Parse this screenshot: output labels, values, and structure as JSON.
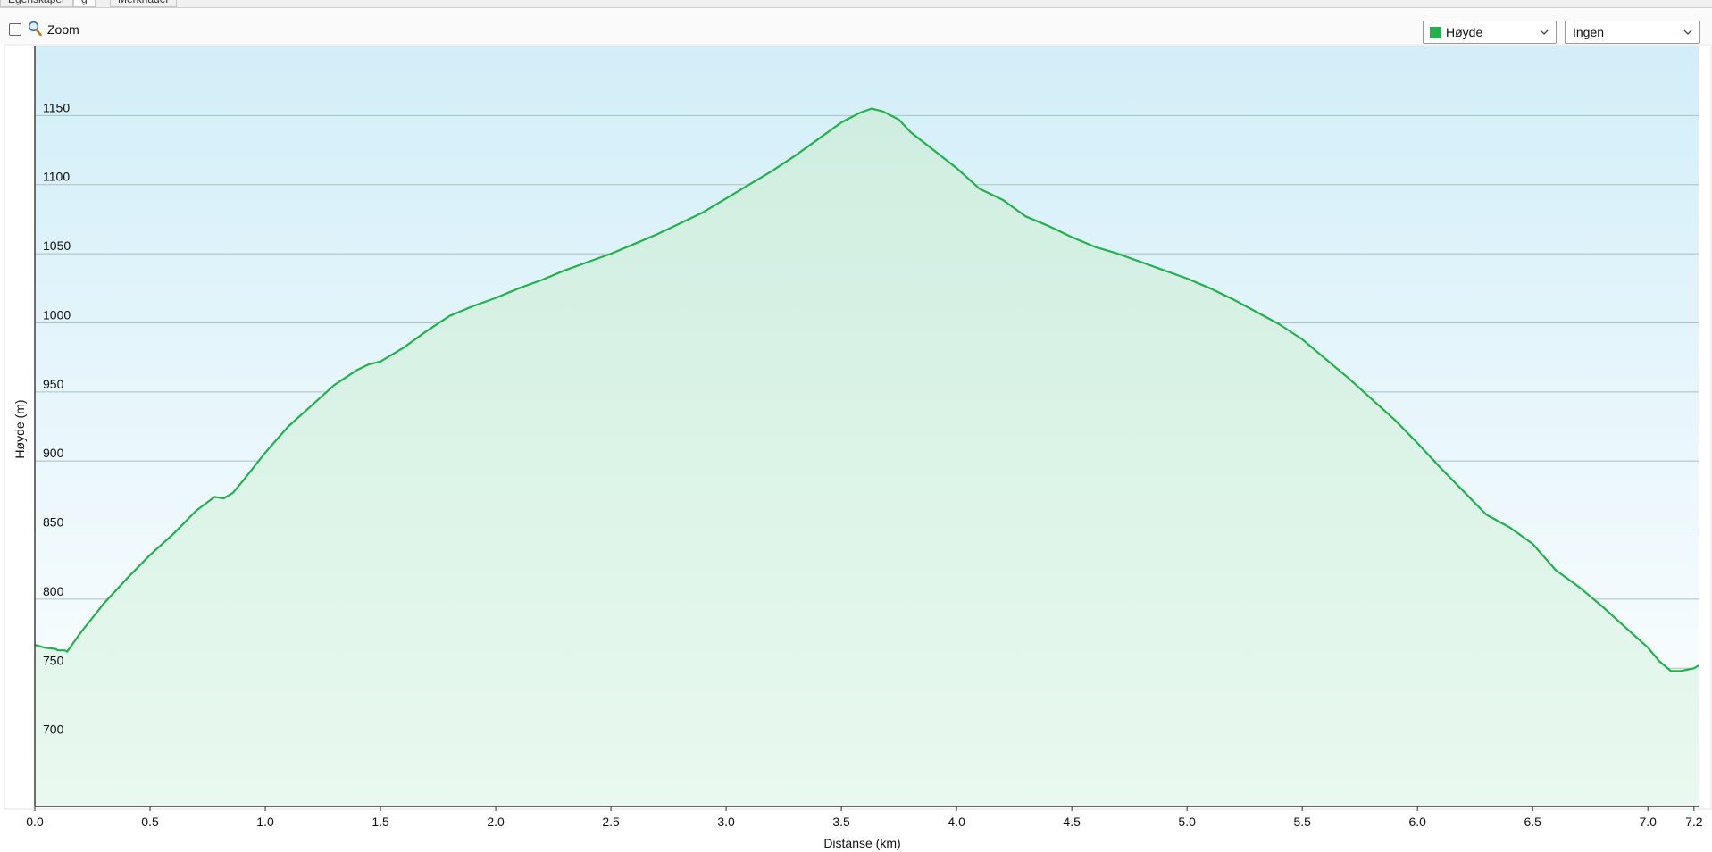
{
  "tabs": [
    {
      "label": "Egenskaper"
    },
    {
      "label": "g"
    },
    {
      "label": "Merknader"
    }
  ],
  "toolbar": {
    "zoom_label": "Zoom",
    "zoom_checked": false,
    "series_select": {
      "value": "Høyde",
      "color": "#22b14c"
    },
    "secondary_select": {
      "value": "Ingen"
    }
  },
  "chart_data": {
    "type": "area",
    "title": "",
    "xlabel": "Distanse  (km)",
    "ylabel": "Høyde (m)",
    "xlim": [
      0,
      7.22
    ],
    "ylim": [
      650,
      1200
    ],
    "grid": true,
    "x_ticks": [
      "0.0",
      "0.5",
      "1.0",
      "1.5",
      "2.0",
      "2.5",
      "3.0",
      "3.5",
      "4.0",
      "4.5",
      "5.0",
      "5.5",
      "6.0",
      "6.5",
      "7.0",
      "7.2"
    ],
    "x_tick_values": [
      0,
      0.5,
      1.0,
      1.5,
      2.0,
      2.5,
      3.0,
      3.5,
      4.0,
      4.5,
      5.0,
      5.5,
      6.0,
      6.5,
      7.0,
      7.2
    ],
    "y_ticks": [
      "700",
      "750",
      "800",
      "850",
      "900",
      "950",
      "1000",
      "1050",
      "1100",
      "1150"
    ],
    "y_tick_values": [
      700,
      750,
      800,
      850,
      900,
      950,
      1000,
      1050,
      1100,
      1150
    ],
    "series": [
      {
        "name": "Høyde",
        "color": "#22b14c",
        "x": [
          0,
          0.04,
          0.09,
          0.1,
          0.13,
          0.14,
          0.2,
          0.3,
          0.4,
          0.5,
          0.6,
          0.7,
          0.78,
          0.82,
          0.86,
          0.9,
          1.0,
          1.1,
          1.2,
          1.3,
          1.4,
          1.45,
          1.5,
          1.6,
          1.7,
          1.8,
          1.9,
          2.0,
          2.1,
          2.2,
          2.3,
          2.4,
          2.5,
          2.6,
          2.7,
          2.8,
          2.9,
          3.0,
          3.1,
          3.2,
          3.3,
          3.4,
          3.5,
          3.58,
          3.63,
          3.68,
          3.75,
          3.8,
          3.9,
          4.0,
          4.1,
          4.2,
          4.3,
          4.4,
          4.5,
          4.6,
          4.7,
          4.8,
          4.9,
          5.0,
          5.1,
          5.2,
          5.3,
          5.4,
          5.5,
          5.6,
          5.7,
          5.8,
          5.9,
          6.0,
          6.1,
          6.2,
          6.3,
          6.4,
          6.5,
          6.6,
          6.7,
          6.8,
          6.9,
          7.0,
          7.05,
          7.1,
          7.14,
          7.2,
          7.22
        ],
        "values": [
          767,
          765,
          764,
          763,
          763,
          762,
          776,
          797,
          815,
          832,
          847,
          864,
          874,
          873,
          877,
          885,
          906,
          925,
          940,
          955,
          966,
          970,
          972,
          982,
          994,
          1005,
          1012,
          1018,
          1025,
          1031,
          1038,
          1044,
          1050,
          1057,
          1064,
          1072,
          1080,
          1090,
          1100,
          1110,
          1121,
          1133,
          1145,
          1152,
          1155,
          1153,
          1147,
          1138,
          1125,
          1112,
          1097,
          1089,
          1077,
          1070,
          1062,
          1055,
          1050,
          1044,
          1038,
          1032,
          1025,
          1017,
          1008,
          999,
          988,
          974,
          960,
          945,
          930,
          913,
          895,
          878,
          861,
          852,
          840,
          821,
          809,
          795,
          780,
          765,
          755,
          748,
          748,
          750,
          752
        ]
      }
    ]
  }
}
